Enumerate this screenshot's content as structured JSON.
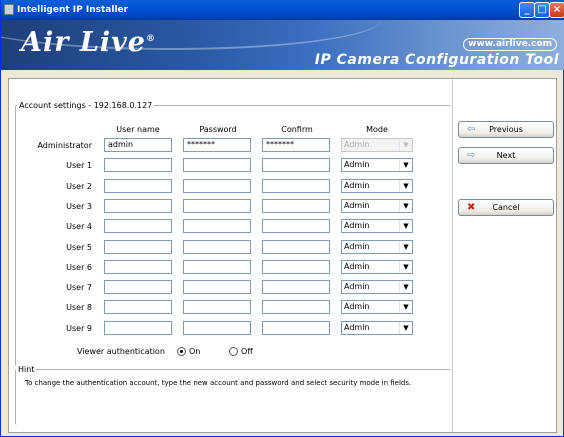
{
  "window": {
    "title": "Intelligent IP Installer"
  },
  "banner": {
    "logo": "Air Live",
    "logo_suffix": "®",
    "url": "www.airlive.com",
    "tool_name": "IP Camera Configuration Tool"
  },
  "account": {
    "legend": "Account settings - 192.168.0.127",
    "columns": {
      "username": "User name",
      "password": "Password",
      "confirm": "Confirm",
      "mode": "Mode"
    },
    "rows": [
      {
        "label": "Administrator",
        "username": "admin",
        "password": "*******",
        "confirm": "*******",
        "mode": "Admin"
      },
      {
        "label": "User 1",
        "username": "",
        "password": "",
        "confirm": "",
        "mode": "Admin"
      },
      {
        "label": "User 2",
        "username": "",
        "password": "",
        "confirm": "",
        "mode": "Admin"
      },
      {
        "label": "User 3",
        "username": "",
        "password": "",
        "confirm": "",
        "mode": "Admin"
      },
      {
        "label": "User 4",
        "username": "",
        "password": "",
        "confirm": "",
        "mode": "Admin"
      },
      {
        "label": "User 5",
        "username": "",
        "password": "",
        "confirm": "",
        "mode": "Admin"
      },
      {
        "label": "User 6",
        "username": "",
        "password": "",
        "confirm": "",
        "mode": "Admin"
      },
      {
        "label": "User 7",
        "username": "",
        "password": "",
        "confirm": "",
        "mode": "Admin"
      },
      {
        "label": "User 8",
        "username": "",
        "password": "",
        "confirm": "",
        "mode": "Admin"
      },
      {
        "label": "User 9",
        "username": "",
        "password": "",
        "confirm": "",
        "mode": "Admin"
      }
    ],
    "viewer_auth": {
      "label": "Viewer authentication",
      "on": "On",
      "off": "Off",
      "selected": "On"
    }
  },
  "hint": {
    "legend": "Hint",
    "text": "To change the authentication account, type the new account and password and select security mode in fields."
  },
  "buttons": {
    "previous": "Previous",
    "next": "Next",
    "cancel": "Cancel"
  },
  "icons": {
    "app": "app-icon",
    "previous": "arrow-left-icon",
    "next": "arrow-right-icon",
    "cancel": "red-x-icon"
  },
  "colors": {
    "title_bar": "#0352d6",
    "banner": "#2a5aa7",
    "cancel_icon": "#c0281c",
    "arrow_icon": "#6b8fcf"
  }
}
